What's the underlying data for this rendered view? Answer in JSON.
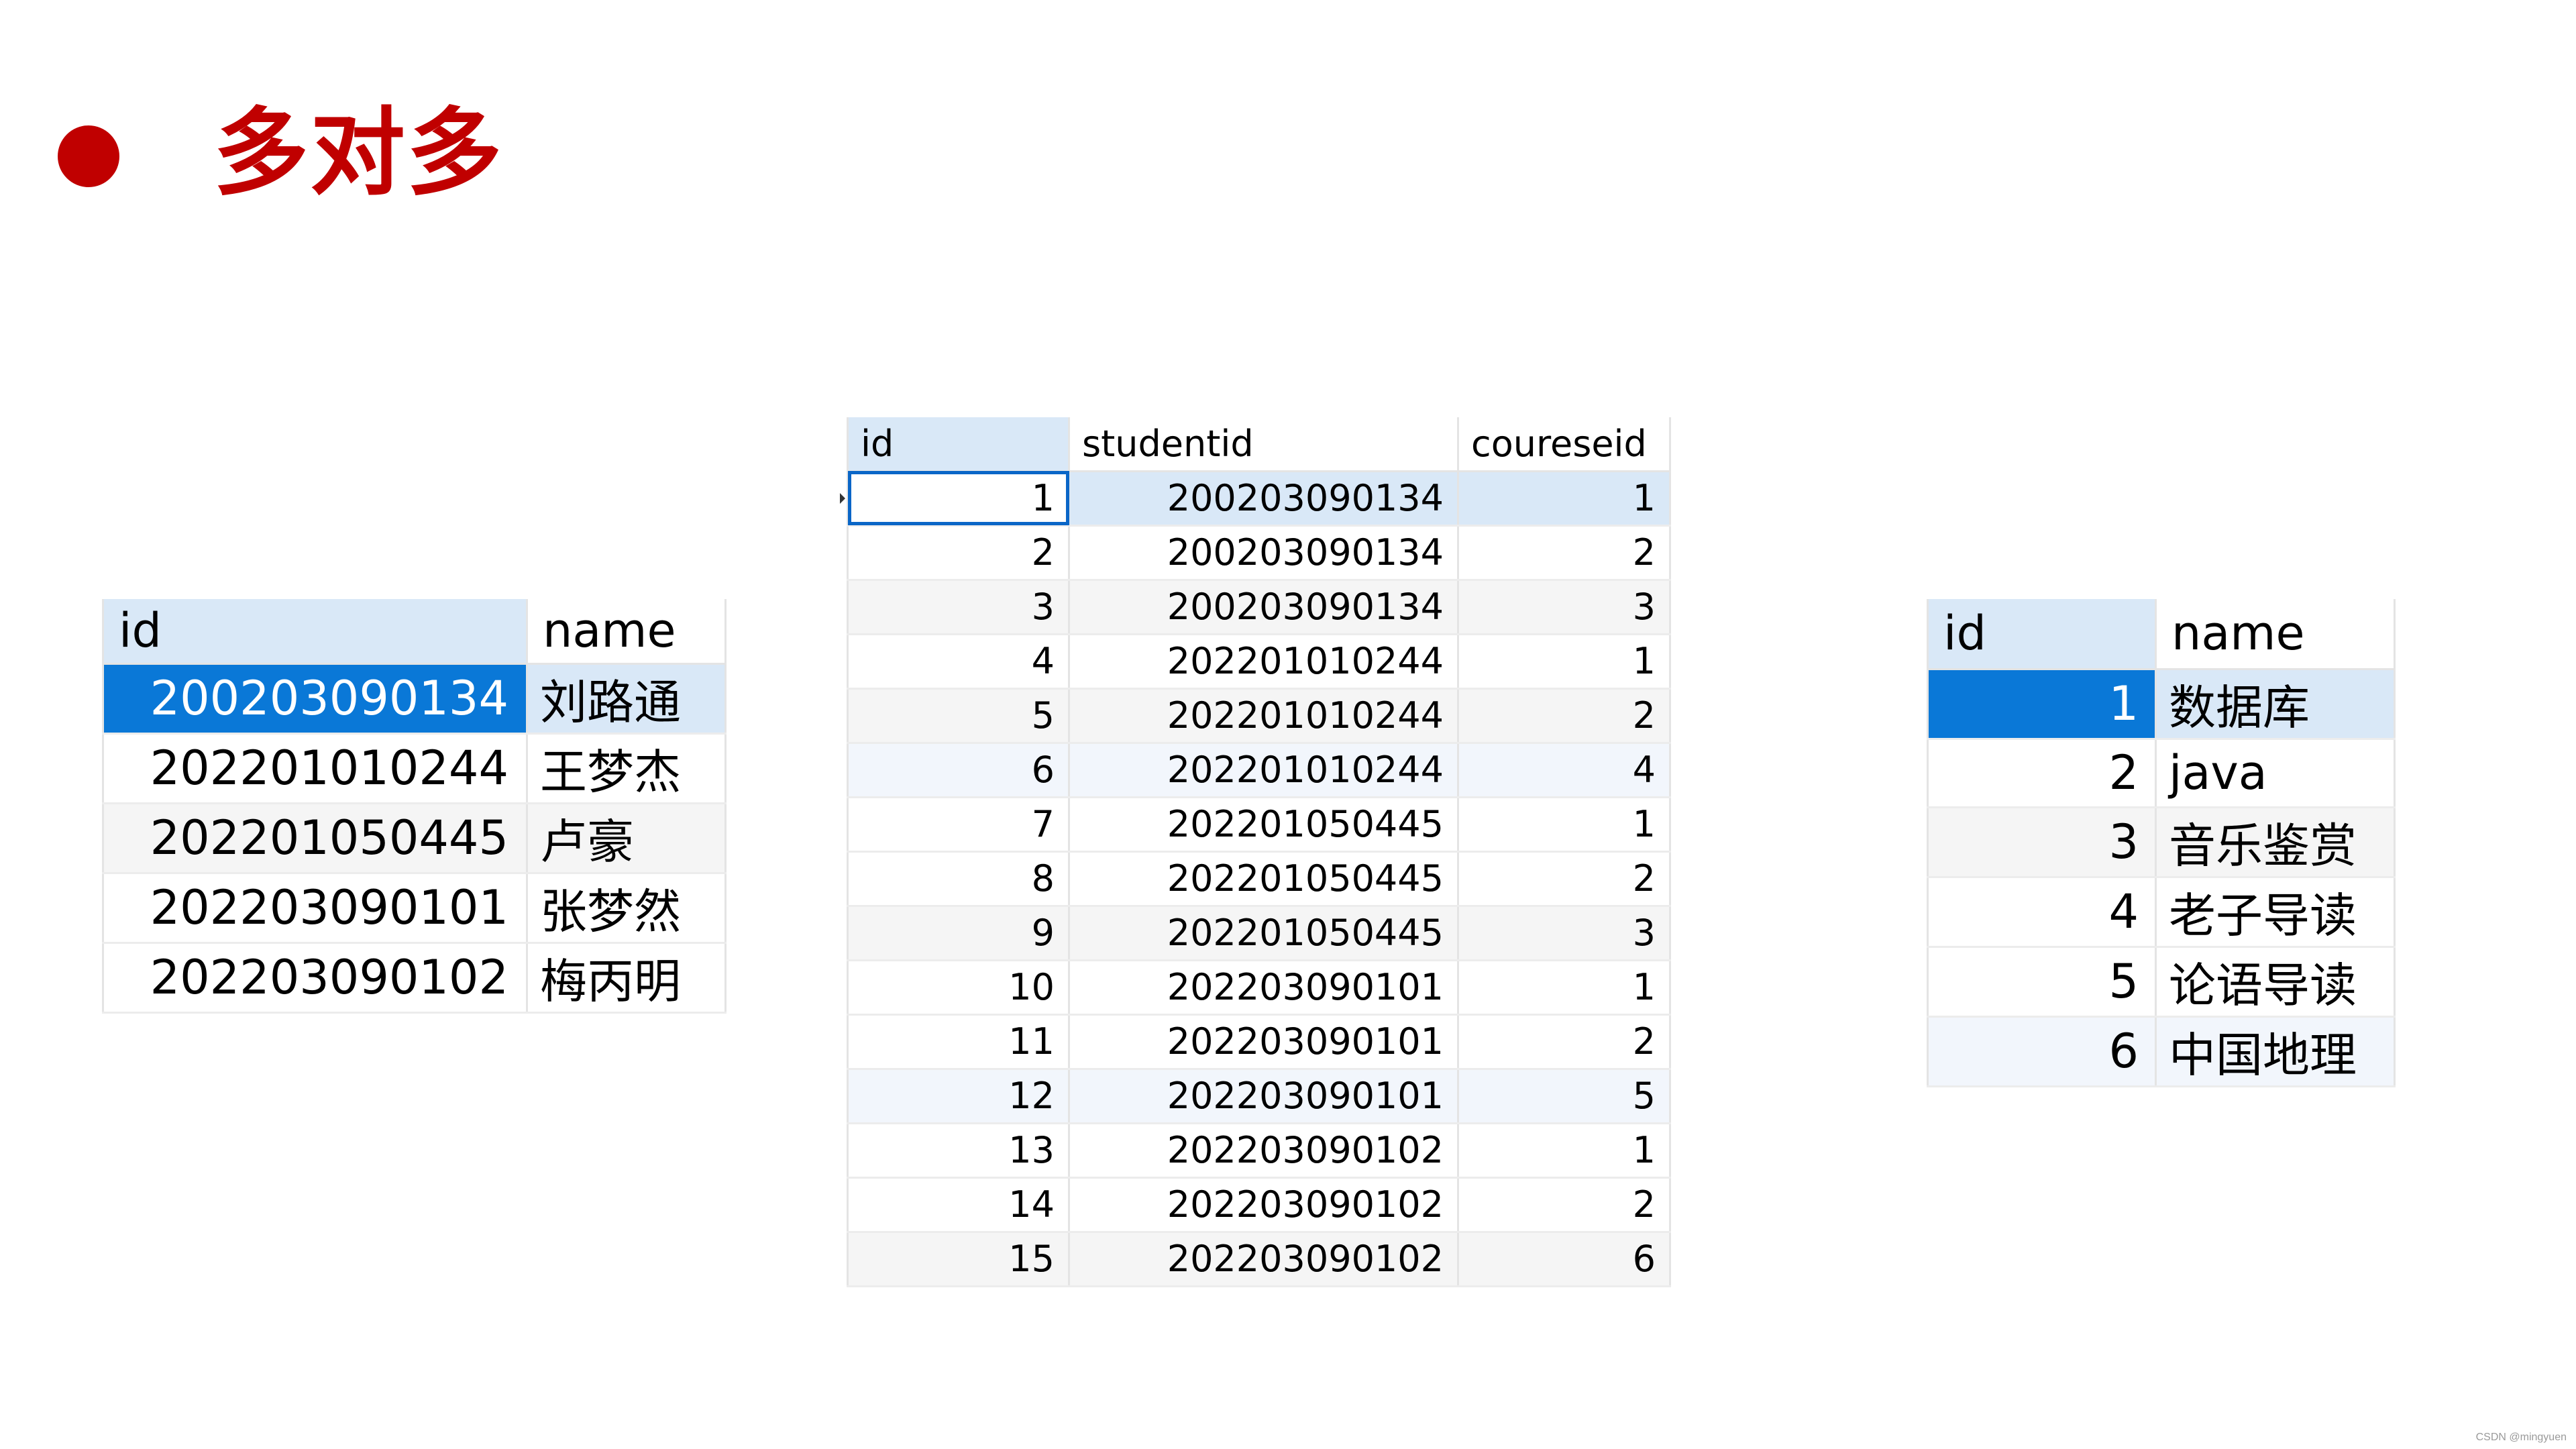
{
  "slide": {
    "title": "多对多",
    "accent_color": "#c00000",
    "bullet_icon": "filled-circle"
  },
  "students_table": {
    "columns": [
      "id",
      "name"
    ],
    "rows": [
      {
        "id": "200203090134",
        "name": "刘路通"
      },
      {
        "id": "202201010244",
        "name": "王梦杰"
      },
      {
        "id": "202201050445",
        "name": "卢豪"
      },
      {
        "id": "202203090101",
        "name": "张梦然"
      },
      {
        "id": "202203090102",
        "name": "梅丙明"
      }
    ],
    "selected_row": 1
  },
  "link_table": {
    "columns": [
      "id",
      "studentid",
      "coureseid"
    ],
    "rows": [
      {
        "id": "1",
        "studentid": "200203090134",
        "coureseid": "1"
      },
      {
        "id": "2",
        "studentid": "200203090134",
        "coureseid": "2"
      },
      {
        "id": "3",
        "studentid": "200203090134",
        "coureseid": "3"
      },
      {
        "id": "4",
        "studentid": "202201010244",
        "coureseid": "1"
      },
      {
        "id": "5",
        "studentid": "202201010244",
        "coureseid": "2"
      },
      {
        "id": "6",
        "studentid": "202201010244",
        "coureseid": "4"
      },
      {
        "id": "7",
        "studentid": "202201050445",
        "coureseid": "1"
      },
      {
        "id": "8",
        "studentid": "202201050445",
        "coureseid": "2"
      },
      {
        "id": "9",
        "studentid": "202201050445",
        "coureseid": "3"
      },
      {
        "id": "10",
        "studentid": "202203090101",
        "coureseid": "1"
      },
      {
        "id": "11",
        "studentid": "202203090101",
        "coureseid": "2"
      },
      {
        "id": "12",
        "studentid": "202203090101",
        "coureseid": "5"
      },
      {
        "id": "13",
        "studentid": "202203090102",
        "coureseid": "1"
      },
      {
        "id": "14",
        "studentid": "202203090102",
        "coureseid": "2"
      },
      {
        "id": "15",
        "studentid": "202203090102",
        "coureseid": "6"
      }
    ],
    "selected_row": 1
  },
  "courses_table": {
    "columns": [
      "id",
      "name"
    ],
    "rows": [
      {
        "id": "1",
        "name": "数据库"
      },
      {
        "id": "2",
        "name": "java"
      },
      {
        "id": "3",
        "name": "音乐鉴赏"
      },
      {
        "id": "4",
        "name": "老子导读"
      },
      {
        "id": "5",
        "name": "论语导读"
      },
      {
        "id": "6",
        "name": "中国地理"
      }
    ],
    "selected_row": 1
  },
  "watermark": "CSDN @mingyuen",
  "colors": {
    "selection_blue": "#0a78d7",
    "selection_light": "#d9e8f7",
    "grid_line": "#e4e4e4"
  }
}
